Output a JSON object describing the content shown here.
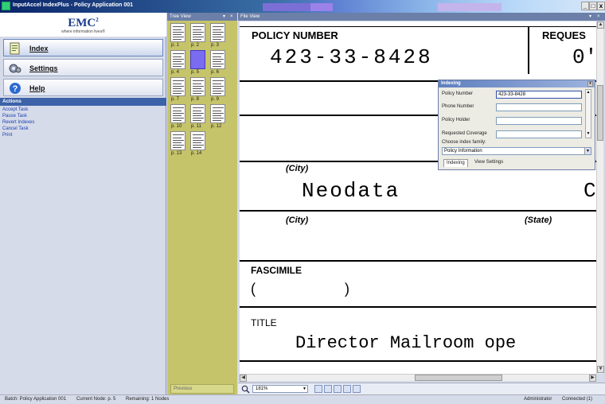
{
  "window": {
    "title": "InputAccel IndexPlus - Policy Application 001",
    "min_label": "_",
    "max_label": "ͦ",
    "close_label": "x"
  },
  "logo": {
    "brand": "EMC",
    "superscript": "2",
    "tagline": "where information lives®"
  },
  "nav": [
    {
      "label": "Index",
      "icon": "index-icon"
    },
    {
      "label": "Settings",
      "icon": "settings-icon"
    },
    {
      "label": "Help",
      "icon": "help-icon"
    }
  ],
  "actions": {
    "header": "Actions",
    "items": [
      "Accept Task",
      "Pause Task",
      "Revert Indexes",
      "Cancel Task",
      "Print"
    ]
  },
  "tree_view": {
    "header": "Tree View",
    "pages": [
      "p. 1",
      "p. 2",
      "p. 3",
      "p. 4",
      "p. 5",
      "p. 6",
      "p. 7",
      "p. 8",
      "p. 9",
      "p. 10",
      "p. 11",
      "p. 12",
      "p. 13",
      "p. 14"
    ],
    "selected_page": "p. 5",
    "previous_label": "Previous"
  },
  "file_view": {
    "header": "File View",
    "doc": {
      "policy_number_label": "POLICY NUMBER",
      "policy_number_value": "423-33-8428",
      "request_label": "REQUES",
      "request_value": "0'",
      "city_label_1": "(City)",
      "state_label_1": "(State)",
      "company_value": "Neodata",
      "company_value_right": "C",
      "city_label_2": "(City)",
      "state_label_2": "(State)",
      "fascimile_label": "FASCIMILE",
      "fascimile_open": "(",
      "fascimile_close": ")",
      "title_label": "TITLE",
      "title_value": "Director Mailroom ope"
    },
    "zoom": "181%"
  },
  "indexing": {
    "title": "Indexing",
    "fields": [
      {
        "label": "Policy Number",
        "value": "423-33-8428"
      },
      {
        "label": "Phone Number",
        "value": ""
      },
      {
        "label": "Policy Holder",
        "value": ""
      },
      {
        "label": "Requested Coverage",
        "value": ""
      }
    ],
    "family_label": "Choose index family:",
    "family_value": "Policy Information",
    "tabs": [
      "Indexing",
      "View Settings"
    ]
  },
  "status": {
    "batch": "Batch: Policy Application 001",
    "node": "Current Node: p. 5",
    "remaining": "Remaining: 1 Nodes",
    "user": "Administrator",
    "connection": "Connected (1)"
  },
  "colors": {
    "title_bar": "#0a246a",
    "tree_bg": "#c6c46a",
    "selection": "#7a6cf0",
    "link": "#1a3fb0"
  }
}
